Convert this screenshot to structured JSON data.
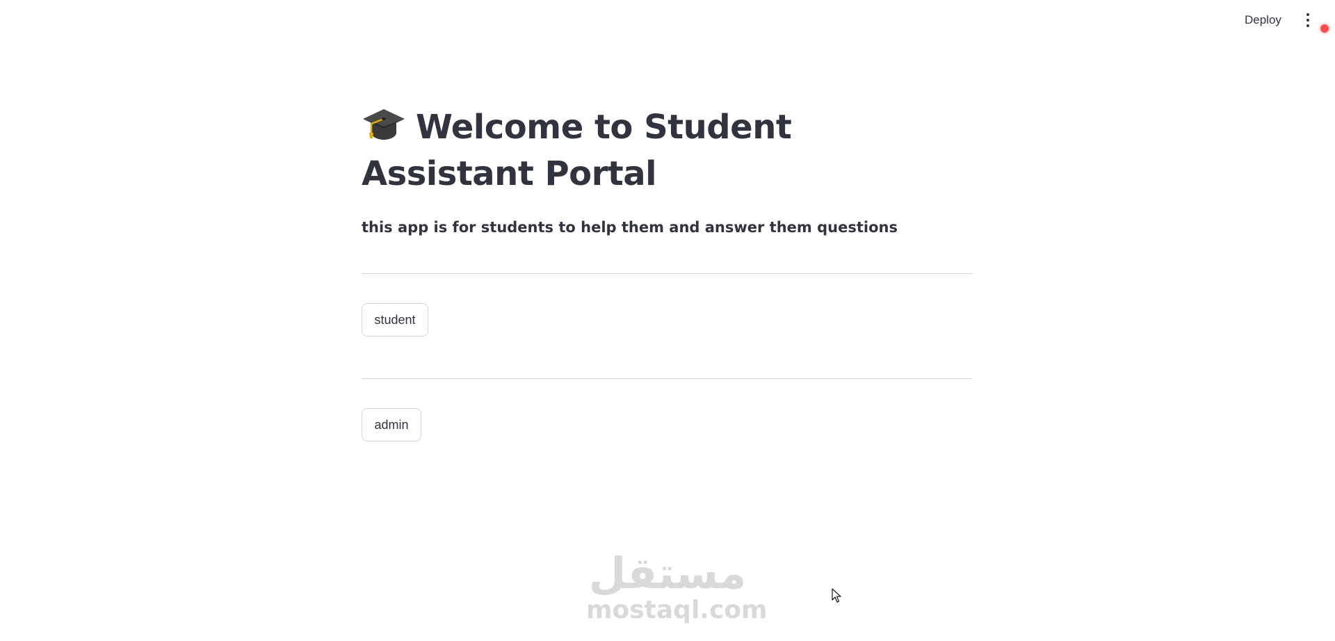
{
  "header": {
    "deploy_label": "Deploy",
    "menu_icon": "kebab-menu-icon",
    "status_color": "#ff4b4b"
  },
  "main": {
    "title_icon": "graduation-cap-icon",
    "title": "Welcome to Student Assistant Portal",
    "subtitle": "this app is for students to help them and answer them questions",
    "buttons": [
      {
        "label": "student"
      },
      {
        "label": "admin"
      }
    ]
  },
  "watermark": {
    "arabic": "مستقل",
    "latin": "mostaql.com"
  },
  "colors": {
    "text": "#31333f",
    "border": "#d6d6d9",
    "background": "#ffffff"
  }
}
